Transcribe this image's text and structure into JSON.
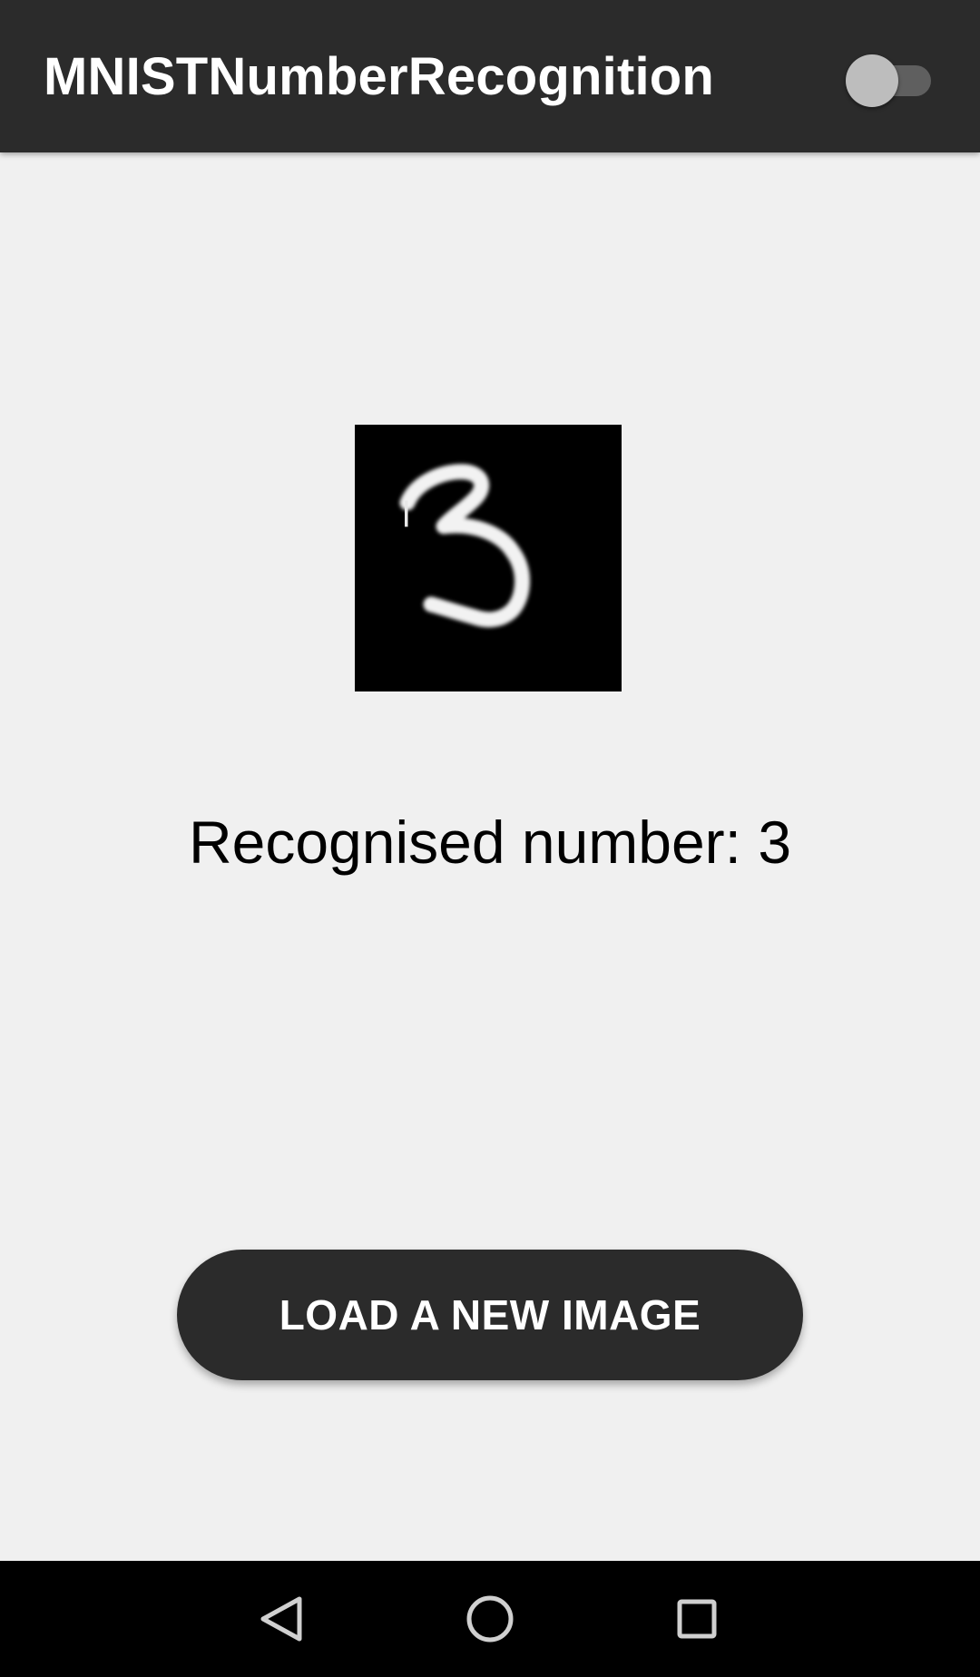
{
  "app_bar": {
    "title": "MNISTNumberRecognition",
    "toggle_state": "off"
  },
  "main": {
    "digit_image_icon": "handwritten-digit-image",
    "result_text": "Recognised number: 3"
  },
  "actions": {
    "load_button_label": "LOAD A NEW IMAGE"
  },
  "nav_bar": {
    "back_icon": "triangle-back-icon",
    "home_icon": "circle-home-icon",
    "recents_icon": "square-recents-icon"
  },
  "colors": {
    "app_bar_bg": "#2b2b2b",
    "page_bg": "#f0f0f0",
    "button_bg": "#2b2b2b",
    "nav_bar_bg": "#000000"
  }
}
